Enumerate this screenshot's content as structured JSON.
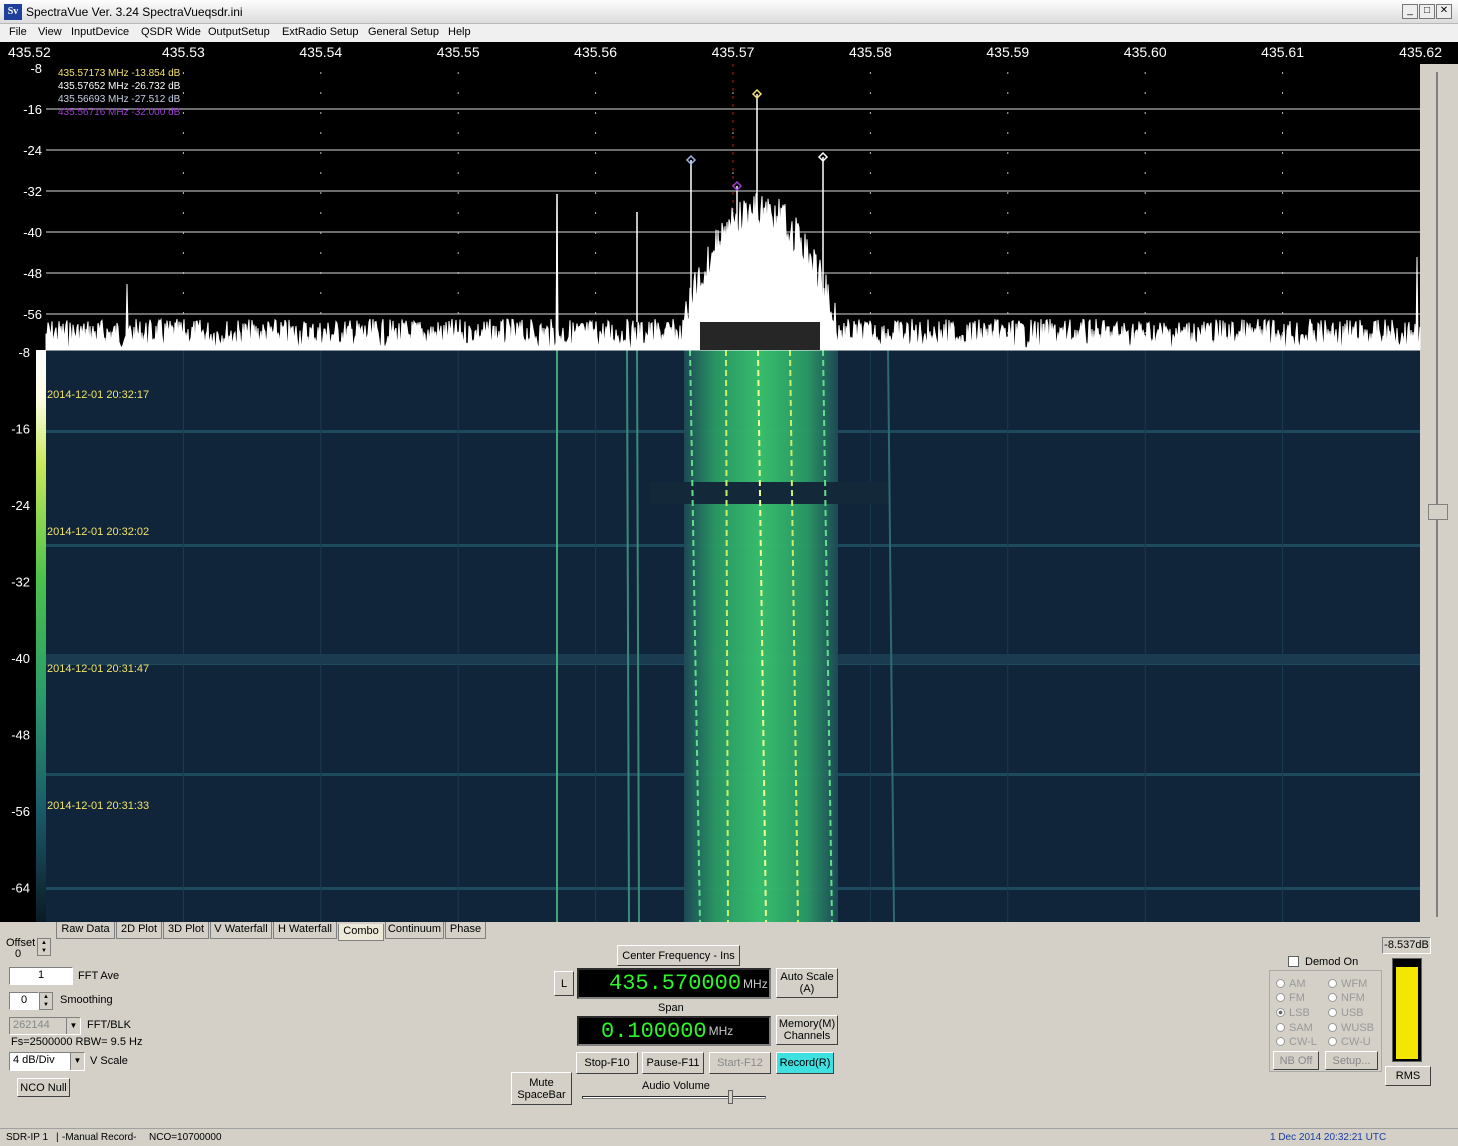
{
  "window": {
    "title": "SpectraVue Ver. 3.24  SpectraVueqsdr.ini",
    "icon": "Sv"
  },
  "menu": [
    "File",
    "View",
    "InputDevice",
    "QSDR Wide",
    "OutputSetup",
    "ExtRadio Setup",
    "General Setup",
    "Help"
  ],
  "freq_axis": [
    "435.52",
    "435.53",
    "435.54",
    "435.55",
    "435.56",
    "435.57",
    "435.58",
    "435.59",
    "435.60",
    "435.61",
    "435.62"
  ],
  "spectrum_db_axis": [
    "-8",
    "-16",
    "-24",
    "-32",
    "-40",
    "-48",
    "-56"
  ],
  "waterfall_db_axis": [
    "-8",
    "-16",
    "-24",
    "-32",
    "-40",
    "-48",
    "-56",
    "-64"
  ],
  "markers": [
    {
      "text": "435.57173 MHz  -13.854 dB",
      "color": "#f4e26a"
    },
    {
      "text": "435.57652 MHz  -26.732 dB",
      "color": "#ffffff"
    },
    {
      "text": "435.56693 MHz  -27.512 dB",
      "color": "#c8d0e8"
    },
    {
      "text": "435.56716 MHz  -32.000 dB",
      "color": "#9a3fd0"
    }
  ],
  "timestamps": [
    "2014-12-01 20:32:17",
    "2014-12-01 20:32:02",
    "2014-12-01 20:31:47",
    "2014-12-01 20:31:33"
  ],
  "tabs": [
    "Raw Data",
    "2D Plot",
    "3D Plot",
    "V Waterfall",
    "H Waterfall",
    "Combo",
    "Continuum",
    "Phase"
  ],
  "controls": {
    "offset_label": "Offset",
    "offset_value": "0",
    "fft_ave_value": "1",
    "fft_ave_label": "FFT Ave",
    "smoothing_value": "0",
    "smoothing_label": "Smoothing",
    "fft_blk_value": "262144",
    "fft_blk_label": "FFT/BLK",
    "fs_info": "Fs=2500000 RBW= 9.5 Hz",
    "vscale_value": "4 dB/Div",
    "vscale_label": "V Scale",
    "nco_null": "NCO Null",
    "mute": "Mute\nSpaceBar",
    "center_freq_button": "Center Frequency - Ins",
    "l_button": "L",
    "center_freq": "435.570000",
    "center_unit": "MHz",
    "auto_scale": "Auto Scale\n(A)",
    "span_label": "Span",
    "span": "0.100000",
    "span_unit": "MHz",
    "memory": "Memory(M)\nChannels",
    "stop": "Stop-F10",
    "pause": "Pause-F11",
    "start": "Start-F12",
    "record": "Record(R)",
    "audio_volume": "Audio Volume",
    "demod_on": "Demod On",
    "modes_left": [
      "AM",
      "FM",
      "LSB",
      "SAM",
      "CW-L"
    ],
    "modes_right": [
      "WFM",
      "NFM",
      "USB",
      "WUSB",
      "CW-U"
    ],
    "selected_mode": "LSB",
    "nb_off": "NB Off",
    "setup": "Setup...",
    "level_readout": "-8.537dB",
    "rms": "RMS"
  },
  "status": {
    "device": "SDR-IP 1",
    "record_mode": "-Manual Record-",
    "nco": "NCO=10700000",
    "datetime": "1 Dec 2014  20:32:21 UTC"
  },
  "colors": {
    "lcd_green": "#2cf52c",
    "record_bg": "#3fe0e0",
    "waterfall_bg": "#10243a",
    "signal_green": "#3fd07a"
  }
}
